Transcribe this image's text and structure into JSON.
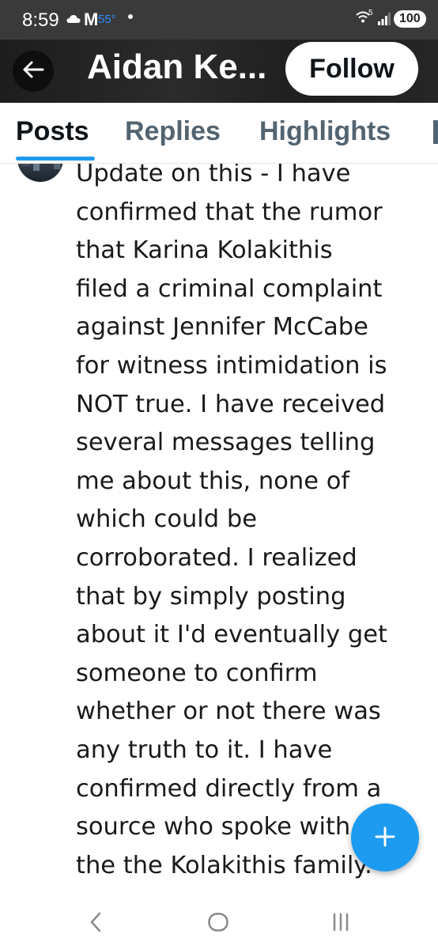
{
  "status_bar": {
    "time": "8:59",
    "temperature": "55°",
    "gmail_icon": "M",
    "network": "5",
    "battery": "100",
    "icons": [
      "cloud-icon",
      "gmail-icon",
      "notification-dot-icon",
      "wifi-icon",
      "signal-icon",
      "battery-icon"
    ]
  },
  "header": {
    "name": "Aidan Ke...",
    "follow_label": "Follow",
    "icons": [
      "back-arrow-icon"
    ]
  },
  "tabs": {
    "items": [
      {
        "label": "Posts",
        "active": true
      },
      {
        "label": "Replies",
        "active": false
      },
      {
        "label": "Highlights",
        "active": false
      }
    ]
  },
  "post": {
    "text": "Update on this - I have\nconfirmed that the rumor\nthat Karina Kolakithis\nfiled a criminal complaint\nagainst Jennifer McCabe\nfor witness intimidation is\nNOT true. I have received\nseveral messages telling\nme about this, none of\nwhich could be\ncorroborated. I realized\nthat by simply posting\nabout it I'd eventually get\nsomeone to confirm\nwhether or not there was\nany truth to it. I have\nconfirmed directly from a\nsource who spoke with\nthe the Kolakithis family."
  },
  "fab": {
    "icon": "plus-icon"
  },
  "nav": {
    "icons": [
      "nav-back-icon",
      "nav-home-icon",
      "nav-recents-icon"
    ]
  },
  "colors": {
    "accent": "#1d9bf0",
    "text": "#0f1419",
    "muted": "#536471",
    "header_bg": "#222222"
  }
}
